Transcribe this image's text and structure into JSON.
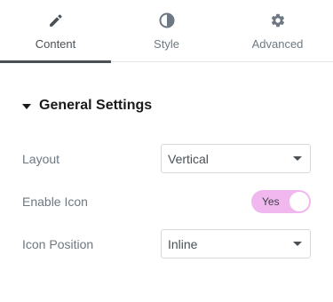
{
  "tabs": [
    {
      "label": "Content",
      "icon": "pencil-icon",
      "active": true
    },
    {
      "label": "Style",
      "icon": "half-circle-icon",
      "active": false
    },
    {
      "label": "Advanced",
      "icon": "gear-icon",
      "active": false
    }
  ],
  "section": {
    "title": "General Settings"
  },
  "fields": {
    "layout": {
      "label": "Layout",
      "value": "Vertical"
    },
    "enable_icon": {
      "label": "Enable Icon",
      "value": "Yes",
      "on": true
    },
    "icon_position": {
      "label": "Icon Position",
      "value": "Inline"
    }
  },
  "colors": {
    "toggle_on": "#f0b8ee",
    "active_tab": "#495157",
    "label": "#6d7882"
  }
}
